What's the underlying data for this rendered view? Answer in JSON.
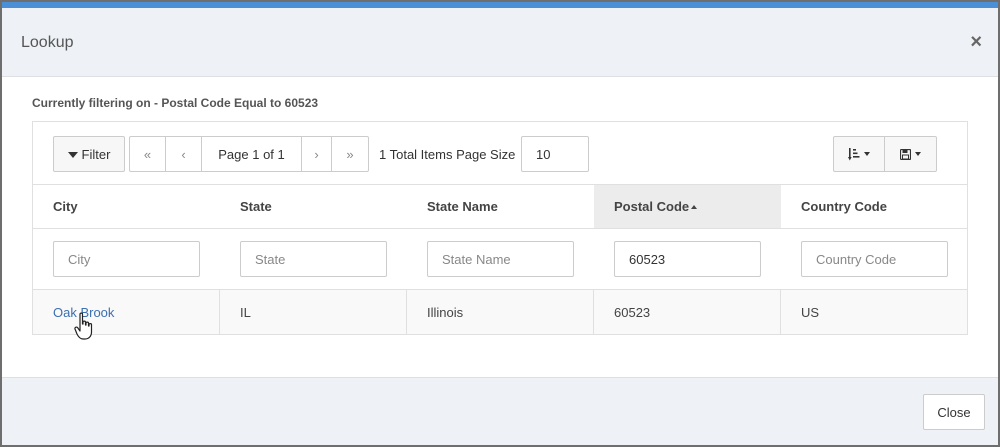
{
  "dialog": {
    "title": "Lookup",
    "close_icon": "×",
    "filter_description": "Currently filtering on - Postal Code Equal to 60523"
  },
  "toolbar": {
    "filter_label": "Filter",
    "pager": {
      "first": "«",
      "prev": "‹",
      "info": "Page 1 of 1",
      "next": "›",
      "last": "»"
    },
    "total_label": "1 Total Items Page Size",
    "page_size": "10",
    "sort_menu_icon": "sort-amount-icon",
    "save_menu_icon": "floppy-disk-icon"
  },
  "columns": [
    {
      "label": "City",
      "filter_placeholder": "City",
      "filter_value": ""
    },
    {
      "label": "State",
      "filter_placeholder": "State",
      "filter_value": ""
    },
    {
      "label": "State Name",
      "filter_placeholder": "State Name",
      "filter_value": ""
    },
    {
      "label": "Postal Code",
      "filter_placeholder": "Postal Code",
      "filter_value": "60523",
      "sorted": "asc"
    },
    {
      "label": "Country Code",
      "filter_placeholder": "Country Code",
      "filter_value": ""
    }
  ],
  "rows": [
    {
      "city": "Oak Brook",
      "state": "IL",
      "state_name": "Illinois",
      "postal_code": "60523",
      "country_code": "US"
    }
  ],
  "footer": {
    "close_label": "Close"
  },
  "colors": {
    "accent_bar": "#4b8fd6",
    "link": "#3a6fb0",
    "header_bg": "#eef1f5"
  }
}
